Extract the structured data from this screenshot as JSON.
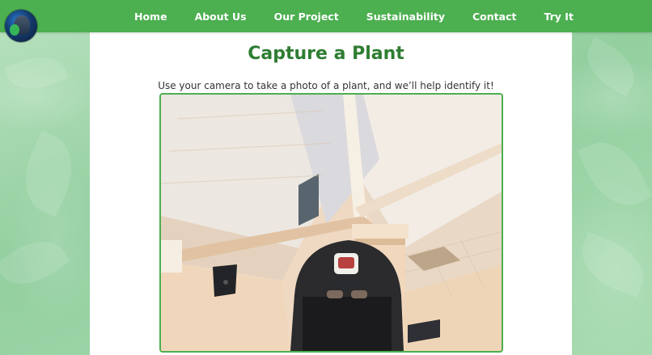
{
  "nav": {
    "items": [
      "Home",
      "About Us",
      "Our Project",
      "Sustainability",
      "Contact",
      "Try It"
    ]
  },
  "main": {
    "title": "Capture a Plant",
    "subtitle": "Use your camera to take a photo of a plant, and we’ll help identify it!"
  },
  "colors": {
    "nav_bg": "#4caf50",
    "title": "#2e7d32",
    "camera_border": "#4caf50"
  }
}
